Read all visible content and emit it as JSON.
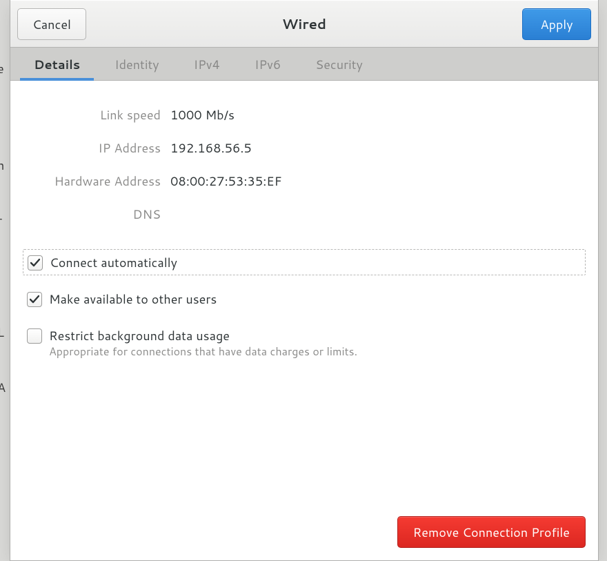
{
  "header": {
    "title": "Wired",
    "cancel_label": "Cancel",
    "apply_label": "Apply"
  },
  "tabs": [
    {
      "label": "Details",
      "active": true
    },
    {
      "label": "Identity",
      "active": false
    },
    {
      "label": "IPv4",
      "active": false
    },
    {
      "label": "IPv6",
      "active": false
    },
    {
      "label": "Security",
      "active": false
    }
  ],
  "details": {
    "fields": [
      {
        "label": "Link speed",
        "value": "1000 Mb/s"
      },
      {
        "label": "IP Address",
        "value": "192.168.56.5"
      },
      {
        "label": "Hardware Address",
        "value": "08:00:27:53:35:EF"
      },
      {
        "label": "DNS",
        "value": ""
      }
    ]
  },
  "options": {
    "connect_automatically": {
      "label": "Connect automatically",
      "checked": true,
      "focused": true
    },
    "available_to_others": {
      "label": "Make available to other users",
      "checked": true
    },
    "restrict_background": {
      "label": "Restrict background data usage",
      "sublabel": "Appropriate for connections that have data charges or limits.",
      "checked": false
    }
  },
  "footer": {
    "remove_label": "Remove Connection Profile"
  },
  "backdrop": {
    "t1": "e",
    "t2": "n",
    "t3": "r",
    "t4": "L",
    "t5": "A"
  }
}
